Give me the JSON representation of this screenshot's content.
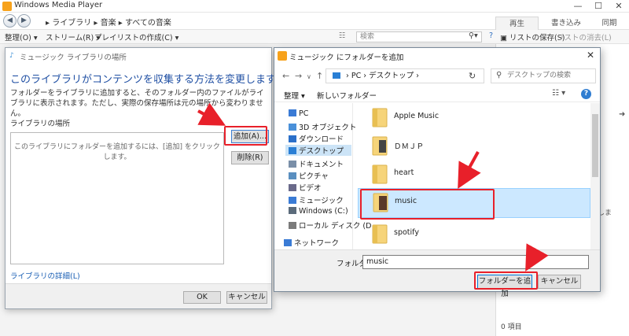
{
  "wmp": {
    "title": "Windows Media Player",
    "breadcrumbs": [
      "ライブラリ",
      "音楽",
      "すべての音楽"
    ],
    "tabs": [
      {
        "label": "再生"
      },
      {
        "label": "書き込み"
      },
      {
        "label": "同期"
      }
    ],
    "toolbar": {
      "organize": "整理(O)",
      "stream": "ストリーム(R)",
      "create_playlist": "プレイリストの作成(C)",
      "search_placeholder": "検索",
      "save_list": "リストの保存(S)",
      "clear_list": "リストの消去(L)"
    },
    "right_panel": {
      "item_count": "0 項目",
      "partial_text": "しま"
    }
  },
  "library_dialog": {
    "title": "ミュージック ライブラリの場所",
    "heading": "このライブラリがコンテンツを収集する方法を変更します",
    "description": "フォルダーをライブラリに追加すると、そのフォルダー内のファイルがライブラリに表示されます。ただし、実際の保存場所は元の場所から変わりません。",
    "locations_label": "ライブラリの場所",
    "empty_message": "このライブラリにフォルダーを追加するには、[追加] をクリックします。",
    "add_button": "追加(A)...",
    "remove_button": "削除(R)",
    "details_link": "ライブラリの詳細(L)",
    "ok_button": "OK",
    "cancel_button": "キャンセル"
  },
  "folder_picker": {
    "title": "ミュージック にフォルダーを追加",
    "path": [
      "PC",
      "デスクトップ"
    ],
    "search_placeholder": "デスクトップの検索",
    "organize": "整理 ▾",
    "new_folder": "新しいフォルダー",
    "nav_items": [
      {
        "label": "PC",
        "icon": "pc-icon",
        "color": "#3a7bd5"
      },
      {
        "label": "3D オブジェクト",
        "icon": "3d-objects-icon",
        "color": "#4a90d9"
      },
      {
        "label": "ダウンロード",
        "icon": "download-icon",
        "color": "#2a6fc9"
      },
      {
        "label": "デスクトップ",
        "icon": "desktop-icon",
        "color": "#2a7fd5"
      },
      {
        "label": "ドキュメント",
        "icon": "documents-icon",
        "color": "#7a8fa8"
      },
      {
        "label": "ピクチャ",
        "icon": "pictures-icon",
        "color": "#5a8fc0"
      },
      {
        "label": "ビデオ",
        "icon": "videos-icon",
        "color": "#6a6a8a"
      },
      {
        "label": "ミュージック",
        "icon": "music-icon",
        "color": "#3a7bd5"
      },
      {
        "label": "Windows (C:)",
        "icon": "drive-icon",
        "color": "#5b6b7b"
      },
      {
        "label": "ローカル ディスク (D",
        "icon": "drive-icon",
        "color": "#7b7b7b"
      },
      {
        "label": "ネットワーク",
        "icon": "network-icon",
        "color": "#3a7bd5"
      }
    ],
    "files": [
      {
        "name": "Apple Music"
      },
      {
        "name": "ＤＭＪＰ"
      },
      {
        "name": "heart"
      },
      {
        "name": "music"
      },
      {
        "name": "spotify"
      }
    ],
    "folder_label": "フォルダー:",
    "folder_value": "music",
    "select_button": "フォルダーを追加",
    "cancel_button": "キャンセル"
  }
}
